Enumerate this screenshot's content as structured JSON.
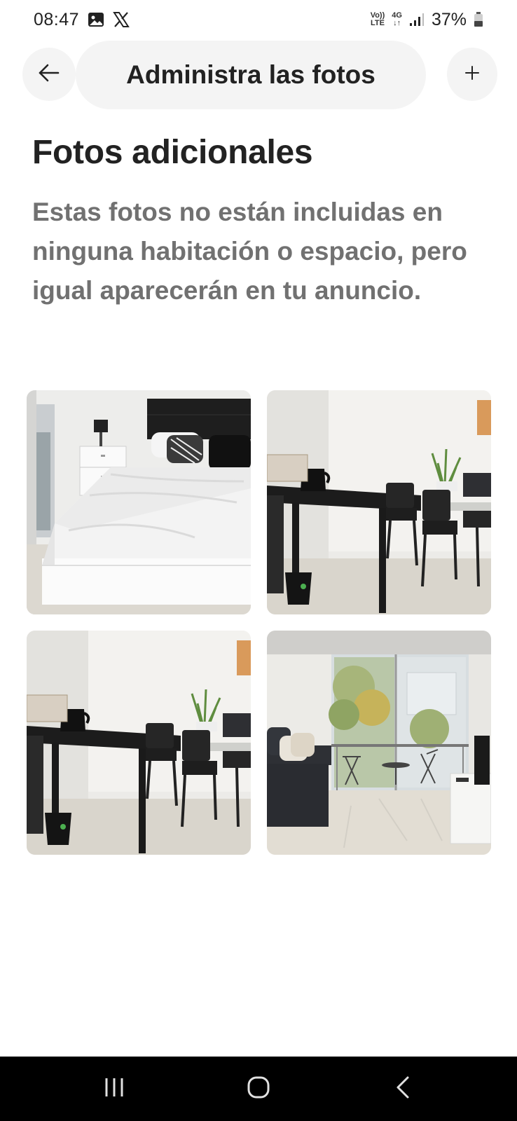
{
  "status_bar": {
    "time": "08:47",
    "volte_top": "Vo))",
    "volte_bottom": "LTE",
    "net_type": "4G",
    "battery_percent": "37%",
    "icons": [
      "gallery-icon",
      "x-logo-icon",
      "signal-icon",
      "battery-icon"
    ]
  },
  "header": {
    "title": "Administra las fotos",
    "back_icon": "arrow-left-icon",
    "add_icon": "plus-icon"
  },
  "section": {
    "title": "Fotos adicionales",
    "description": "Estas fotos no están incluidas en ninguna habitación o espacio, pero igual aparecerán en tu anuncio."
  },
  "photos": [
    {
      "subject": "bedroom-bed"
    },
    {
      "subject": "kitchen-bar-table"
    },
    {
      "subject": "kitchen-bar-table"
    },
    {
      "subject": "living-room-balcony"
    }
  ],
  "nav_bar": {
    "icons": [
      "recent-apps-icon",
      "home-icon",
      "back-icon"
    ]
  },
  "colors": {
    "pill_bg": "#f4f4f4",
    "text_primary": "#222222",
    "text_secondary": "#717171",
    "nav_bg": "#000000"
  }
}
